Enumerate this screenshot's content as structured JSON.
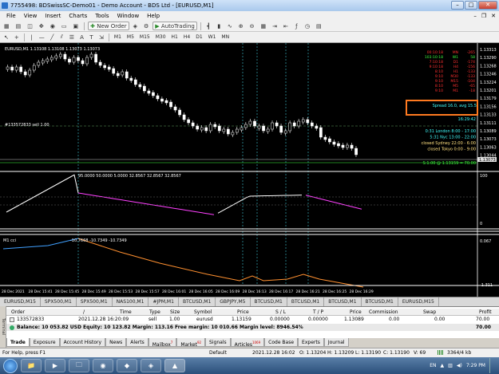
{
  "title": "7755498: BDSwissSC-Demo01 - Demo Account - BDS Ltd - [EURUSD,M1]",
  "menu": [
    "File",
    "View",
    "Insert",
    "Charts",
    "Tools",
    "Window",
    "Help"
  ],
  "toolbar": {
    "new_order": "New Order",
    "autotrading": "AutoTrading"
  },
  "timeframes": [
    "M1",
    "M5",
    "M15",
    "M30",
    "H1",
    "H4",
    "D1",
    "W1",
    "MN"
  ],
  "chart": {
    "header": "EURUSD,M1  1.13108 1.13108 1.13073 1.13073",
    "trade_label": "#133572833 sell 1.00",
    "prices": [
      "1.13313",
      "1.13290",
      "1.13268",
      "1.13246",
      "1.13224",
      "1.13201",
      "1.13179",
      "1.13156",
      "1.13133",
      "1.13111",
      "1.13089",
      "1.13073",
      "1.13063",
      "1.13044"
    ],
    "bid_tag": "1.13073",
    "overlay": [
      {
        "text": "00:10:18",
        "col": "#ff3030"
      },
      {
        "text": "103:10:18",
        "col": "#40ff40"
      },
      {
        "text": "7:10:18",
        "col": "#ff3030"
      },
      {
        "text": "9:10:18",
        "col": "#ff3030"
      },
      {
        "text": "8:10",
        "col": "#ff3030"
      },
      {
        "text": "9:10",
        "col": "#ff3030"
      },
      {
        "text": "9:10",
        "col": "#ff3030"
      },
      {
        "text": "8:10",
        "col": "#ff3030"
      },
      {
        "text": "9:10",
        "col": "#ff3030"
      }
    ],
    "overlay_mid": [
      {
        "text": "MN",
        "col": "#ff3030"
      },
      {
        "text": "W1",
        "col": "#40ff40"
      },
      {
        "text": "D1",
        "col": "#ff3030"
      },
      {
        "text": "H4",
        "col": "#ff3030"
      },
      {
        "text": "H1",
        "col": "#ff3030"
      },
      {
        "text": "M30",
        "col": "#ff3030"
      },
      {
        "text": "M15",
        "col": "#ff3030"
      },
      {
        "text": "M5",
        "col": "#ff3030"
      },
      {
        "text": "M1",
        "col": "#ff3030"
      }
    ],
    "overlay_vals": [
      {
        "text": "-265",
        "col": "#ff3030"
      },
      {
        "text": "58",
        "col": "#40ff40"
      },
      {
        "text": "-174",
        "col": "#ff3030"
      },
      {
        "text": "-156",
        "col": "#ff3030"
      },
      {
        "text": "-133",
        "col": "#ff3030"
      },
      {
        "text": "-133",
        "col": "#ff3030"
      },
      {
        "text": "-104",
        "col": "#ff3030"
      },
      {
        "text": "-65",
        "col": "#ff3030"
      },
      {
        "text": "-18",
        "col": "#ff3030"
      }
    ],
    "spread": "Spread 16.0, avg 15.5",
    "clock": "16:29:42",
    "sessions": [
      "0:31 London 8:00 - 17:00",
      "5:31 Nyc 13:00 - 22:00",
      "closed Sydney 22:00 - 6:00",
      "closed Tokyo 0:00 - 9:00"
    ],
    "swap_text": "S:1.00 @ 1.13159 = 70.00",
    "rsi_label": "95.0000 50.0000 5.0000 32.8567 32.8567 32.8567",
    "rsi_levels": [
      "100",
      "0"
    ],
    "cci_label": "M1 cci",
    "cci_vals": "-10.7668 -10.7349 -10.7349",
    "cci_levels": [
      "0.067",
      "-1.311"
    ],
    "times": [
      "28 Dec 2021",
      "28 Dec 15:41",
      "28 Dec 15:45",
      "28 Dec 15:49",
      "28 Dec 15:53",
      "28 Dec 15:57",
      "28 Dec 16:01",
      "28 Dec 16:05",
      "28 Dec 16:09",
      "28 Dec 16:13",
      "28 Dec 16:17",
      "28 Dec 16:21",
      "28 Dec 16:25",
      "28 Dec 16:29"
    ]
  },
  "symbol_tabs": [
    "EURUSD,M15",
    "SPX500,M1",
    "SPX500,M1",
    "NAS100,M1",
    "#JPM,M1",
    "BTCUSD,M1",
    "GBPJPY,M5",
    "BTCUSD,M1",
    "BTCUSD,M1",
    "BTCUSD,M1",
    "BTCUSD,M1",
    "EURUSD,M15"
  ],
  "terminal": {
    "headers": [
      "Order",
      "/",
      "Time",
      "Type",
      "Size",
      "Symbol",
      "Price",
      "S / L",
      "T / P",
      "Price",
      "Commission",
      "Swap",
      "Profit"
    ],
    "row": [
      "133572833",
      "2021.12.28 16:20:09",
      "sell",
      "1.00",
      "eurusd",
      "1.13159",
      "0.00000",
      "0.00000",
      "1.13089",
      "0.00",
      "0.00",
      "70.00"
    ],
    "balance": "Balance: 10 053.82 USD  Equity: 10 123.82  Margin: 113.16  Free margin: 10 010.66  Margin level: 8946.54%",
    "balance_profit": "70.00",
    "side_label": "Terminal",
    "tabs": [
      {
        "l": "Trade",
        "s": ""
      },
      {
        "l": "Exposure",
        "s": ""
      },
      {
        "l": "Account History",
        "s": ""
      },
      {
        "l": "News",
        "s": ""
      },
      {
        "l": "Alerts",
        "s": ""
      },
      {
        "l": "Mailbox",
        "s": "7"
      },
      {
        "l": "Market",
        "s": "92"
      },
      {
        "l": "Signals",
        "s": ""
      },
      {
        "l": "Articles",
        "s": "1069"
      },
      {
        "l": "Code Base",
        "s": ""
      },
      {
        "l": "Experts",
        "s": ""
      },
      {
        "l": "Journal",
        "s": ""
      }
    ]
  },
  "status": {
    "help": "For Help, press F1",
    "profile": "Default",
    "dt": "2021.12.28 16:02",
    "o": "O: 1.13204",
    "h": "H: 1.13209",
    "l": "L: 1.13190",
    "cl": "C: 1.13190",
    "v": "V: 69",
    "kb": "3364/4 kb"
  },
  "taskbar": {
    "lang": "EN",
    "time": "7:29 PM"
  }
}
